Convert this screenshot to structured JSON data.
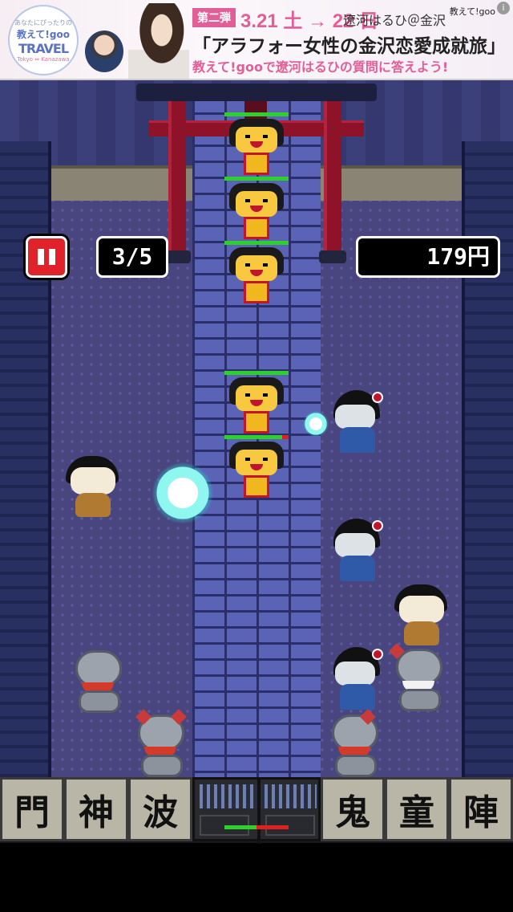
{
  "ad": {
    "logo_line1": "あなたにぴったりの",
    "logo_line2": "教えて!goo",
    "logo_line3": "TRAVEL",
    "logo_line4": "Tokyo ⇔ Kanazawa",
    "badge": "第二弾",
    "date": "3.21 土 → 22 日",
    "location": "遼河はるひ＠金沢",
    "corner": "教えて!goo",
    "info": "i",
    "title": "「アラフォー女性の金沢恋愛成就旅」",
    "subtitle": "教えて!gooで遼河はるひの質問に答えよう!"
  },
  "hud": {
    "wave": "3/5",
    "money": "179円"
  },
  "enemies": [
    {
      "hp": 1.0
    },
    {
      "hp": 1.0
    },
    {
      "hp": 1.0
    },
    {
      "hp": 1.0
    },
    {
      "hp": 0.9
    }
  ],
  "gate_hp": 0.5,
  "toolbar": {
    "left": [
      "門",
      "神",
      "波"
    ],
    "right": [
      "鬼",
      "童",
      "陣"
    ]
  },
  "icons": {
    "pause": "pause-icon",
    "info": "info-icon"
  },
  "colors": {
    "pause_button": "#e0222b",
    "torii": "#8e1329",
    "hp_full": "#2cd12c",
    "hp_lost": "#e02020",
    "orb": "#8ff7f0",
    "ad_accent": "#e15e97"
  }
}
